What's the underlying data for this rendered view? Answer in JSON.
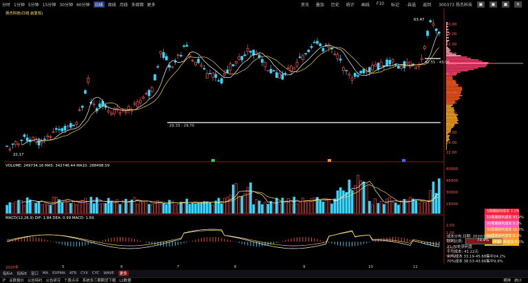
{
  "toolbar": {
    "periods": [
      "分时",
      "1分钟",
      "5分钟",
      "15分钟",
      "30分钟",
      "60分钟",
      "日线",
      "周线",
      "月线",
      "多周期",
      "更多"
    ],
    "active_period": "日线",
    "right_tools": [
      "资讯",
      "叠加",
      "历史",
      "统计",
      "画线",
      "F10",
      "标记",
      "-自选",
      "返回"
    ],
    "stock_title": "300373 扬杰科技",
    "window_controls": [
      "▣",
      "▣",
      "▣",
      "✕"
    ]
  },
  "main": {
    "header": "扬杰科技(日线 前复权)",
    "y_ticks": [
      "60.00",
      "56.00",
      "52.00",
      "48.00",
      "45.00",
      "42.00",
      "39.00",
      "36.00",
      "33.00",
      "30.00",
      "28.00",
      "26.00",
      "24.00",
      "22.00"
    ],
    "labels": {
      "low": "22.17",
      "high": "63.47",
      "support": "29.33 - 29.70",
      "peak_range": "42.55 - 43.06"
    }
  },
  "volume": {
    "header": "VOLUME: 249734.16  MA5: 342746.44  MA10: 288498.59",
    "y_ticks": [
      "60000",
      "45000",
      "30000",
      "15000"
    ],
    "colors": {
      "up": "#ff4d4d",
      "down": "#35d8ff"
    }
  },
  "macd": {
    "header": "MACD(12,26,9)  DIF: 1.84  DEA: 0.99  MACD: 1.69",
    "y_ticks": [
      "2.00",
      "1.00",
      "0.00",
      "-1.00",
      "-2.00"
    ]
  },
  "profile_legend": [
    {
      "label": "5周期获利成本 7.1%",
      "color": "#ff1f3a"
    },
    {
      "label": "10周期获利成本 43.9%",
      "color": "#ff3b6b"
    },
    {
      "label": "20周期获利成本 9.3%",
      "color": "#ff5cb8"
    },
    {
      "label": "30周期获利成本 10.6%",
      "color": "#ff7a4a"
    },
    {
      "label": "60周期获利成本 8.1%",
      "color": "#ff9a2e"
    },
    {
      "label": "100周期获利成本 0.6%",
      "color": "#ffb020"
    }
  ],
  "cost_info": {
    "title": "成本分布,日期: 2020/11/06",
    "profit_ratio_label": "获利比例:",
    "profit_ratio": "73.9%",
    "profit_price": "21.70处获利盘",
    "avg_cost": "平均成本: 41.22元",
    "cost90": "90%成本 33.19-45.68集中24.2%",
    "cost70": "70%成本 38.53-43.66集中9.9%"
  },
  "timeline": [
    "2020年",
    "5",
    "6",
    "7",
    "8",
    "9",
    "10",
    "11"
  ],
  "tabs": [
    "指标A",
    "指标B",
    "窗口",
    "MA",
    "EXPMA",
    "ATR",
    "CYX",
    "CYC",
    "WAVE",
    "更多"
  ],
  "active_tab": "更多",
  "status": [
    "沪",
    "关联报价",
    "公告特约",
    "公告研究",
    "个股点评",
    "系统多三期期货下载",
    "L2数据"
  ],
  "right_pager": [
    "横排",
    "统计"
  ]
}
